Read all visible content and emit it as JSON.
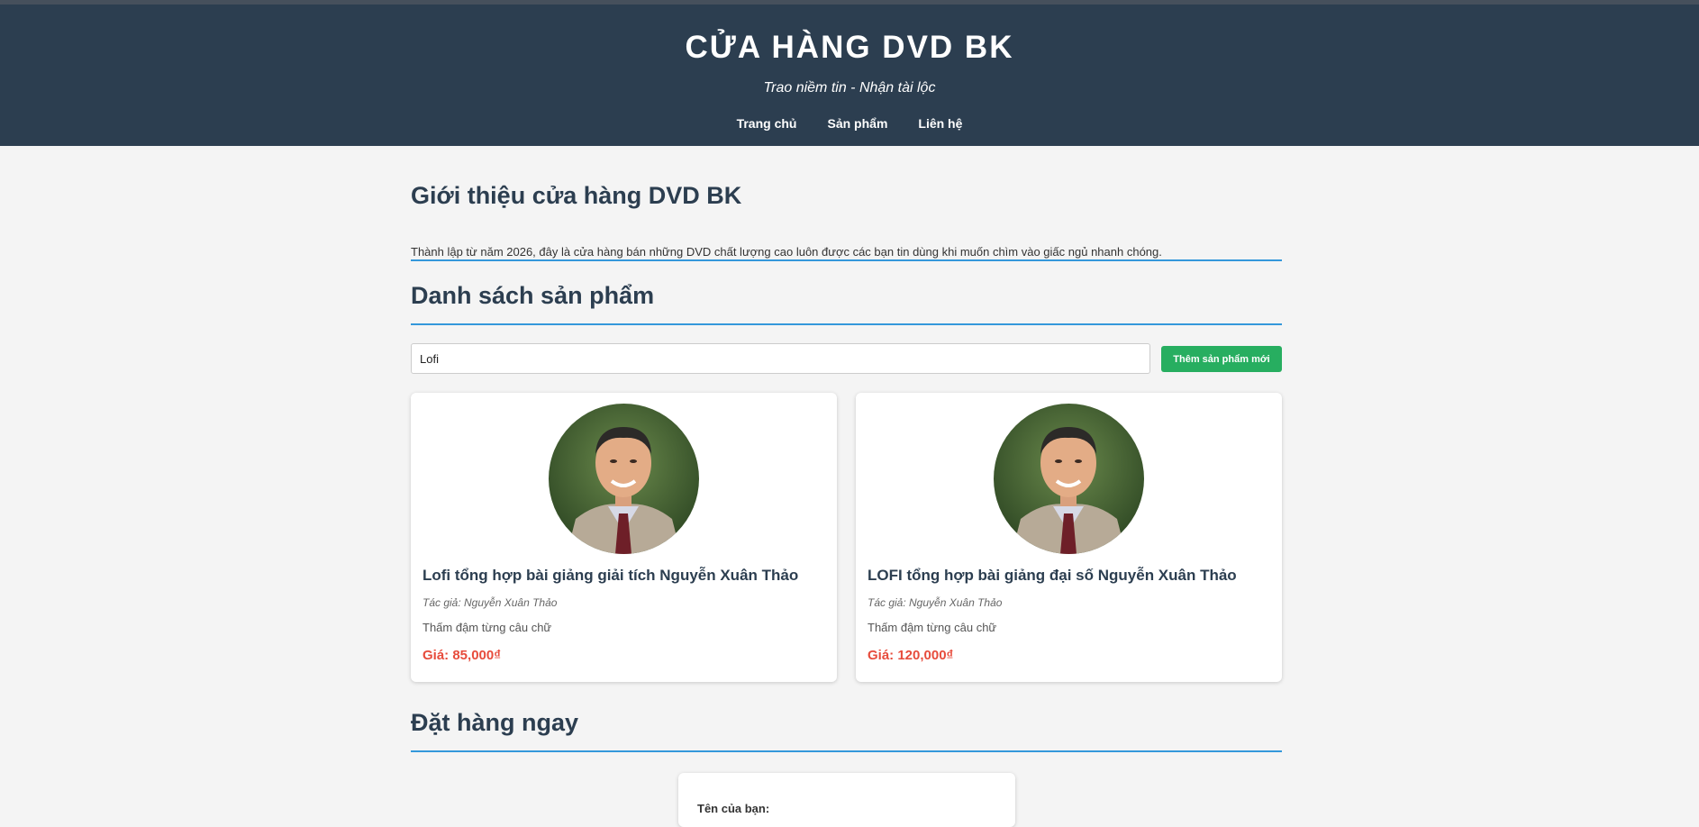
{
  "header": {
    "title": "CỬA HÀNG DVD BK",
    "tagline": "Trao niềm tin - Nhận tài lộc",
    "nav": [
      "Trang chủ",
      "Sản phẩm",
      "Liên hệ"
    ]
  },
  "intro": {
    "heading": "Giới thiệu cửa hàng DVD BK",
    "text": "Thành lập từ năm 2026, đây là cửa hàng bán những DVD chất lượng cao luôn được các bạn tin dùng khi muốn chìm vào giấc ngủ nhanh chóng."
  },
  "products": {
    "heading": "Danh sách sản phẩm",
    "search_value": "Lofi",
    "add_button": "Thêm sản phẩm mới",
    "items": [
      {
        "title": "Lofi tổng hợp bài giảng giải tích Nguyễn Xuân Thảo",
        "author": "Tác giả: Nguyễn Xuân Thảo",
        "description": "Thấm đậm từng câu chữ",
        "price": "Giá: 85,000₫"
      },
      {
        "title": "LOFI tổng hợp bài giảng đại số Nguyễn Xuân Thảo",
        "author": "Tác giả: Nguyễn Xuân Thảo",
        "description": "Thấm đậm từng câu chữ",
        "price": "Giá: 120,000₫"
      }
    ]
  },
  "order": {
    "heading": "Đặt hàng ngay",
    "name_label": "Tên của bạn:"
  },
  "colors": {
    "header_bg": "#2c3e50",
    "accent_line": "#3498db",
    "add_button": "#27ae60",
    "price": "#e74c3c"
  }
}
